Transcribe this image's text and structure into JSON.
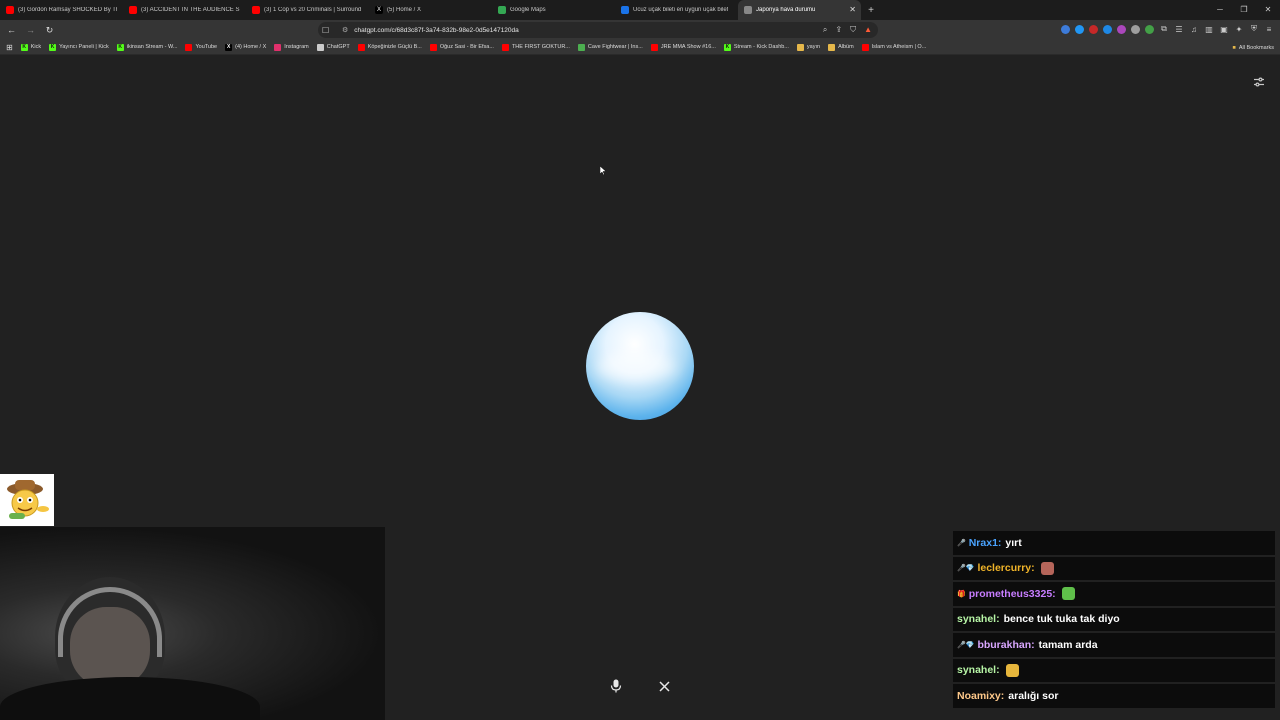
{
  "tabs": [
    {
      "title": "(3) Gordon Ramsay SHOCKED By Th",
      "favicon_color": "#ff0000"
    },
    {
      "title": "(3) ACCIDENT IN THE AUDIENCE STA",
      "favicon_color": "#ff0000"
    },
    {
      "title": "(3) 1 Cop vs 20 Criminals | Surround",
      "favicon_color": "#ff0000"
    },
    {
      "title": "(5) Home / X",
      "favicon_color": "#000000",
      "favicon_glyph": "X"
    },
    {
      "title": "Google Maps",
      "favicon_color": "#34a853"
    },
    {
      "title": "Ucuz uçak bileti en uygun uçak bilet",
      "favicon_color": "#1a73e8"
    },
    {
      "title": "Japonya hava durumu",
      "favicon_color": "#888888",
      "active": true
    }
  ],
  "toolbar": {
    "url": "chatgpt.com/c/68d3c87f-3a74-832b-98e2-0d5e147120da"
  },
  "bookmarks": [
    {
      "label": "Kick",
      "color": "#53fc18",
      "glyph": "K"
    },
    {
      "label": "Yayıncı Paneli | Kick",
      "color": "#53fc18",
      "glyph": "K"
    },
    {
      "label": "ikinsan Stream - W...",
      "color": "#53fc18",
      "glyph": "K"
    },
    {
      "label": "YouTube",
      "color": "#ff0000",
      "glyph": ""
    },
    {
      "label": "(4) Home / X",
      "color": "#000000",
      "glyph": "X"
    },
    {
      "label": "Instagram",
      "color": "#e1306c",
      "glyph": ""
    },
    {
      "label": "ChatGPT",
      "color": "#cccccc",
      "glyph": ""
    },
    {
      "label": "Köpeğinizle Güçlü B...",
      "color": "#ff0000",
      "glyph": ""
    },
    {
      "label": "Oğuz Sasi - Bir Efsa...",
      "color": "#ff0000",
      "glyph": ""
    },
    {
      "label": "THE FIRST GOKTUR...",
      "color": "#ff0000",
      "glyph": ""
    },
    {
      "label": "Cave Fightwear | Ins...",
      "color": "#4caf50",
      "glyph": ""
    },
    {
      "label": "JRE MMA Show #16...",
      "color": "#ff0000",
      "glyph": ""
    },
    {
      "label": "Stream - Kick Dashb...",
      "color": "#53fc18",
      "glyph": "K"
    },
    {
      "label": "yayın",
      "color": "#e6b84a",
      "glyph": ""
    },
    {
      "label": "Albüm",
      "color": "#e6b84a",
      "glyph": ""
    },
    {
      "label": "Islam vs Atheism | O...",
      "color": "#ff0000",
      "glyph": ""
    }
  ],
  "all_bookmarks_label": "All Bookmarks",
  "chat": [
    {
      "user": "Nrax1:",
      "color": "#4aa3ff",
      "text": "yırt",
      "badge": "🎤",
      "emote": ""
    },
    {
      "user": "leclercurry:",
      "color": "#f0b429",
      "text": "",
      "badge": "🎤💎",
      "emote": "#b5655a"
    },
    {
      "user": "prometheus3325:",
      "color": "#c77dff",
      "text": "",
      "badge": "🎁",
      "emote": "#5fbf4a"
    },
    {
      "user": "synahel:",
      "color": "#b7f5a6",
      "text": "bence tuk tuka tak diyo",
      "badge": "",
      "emote": ""
    },
    {
      "user": "bburakhan:",
      "color": "#d9a7ff",
      "text": "tamam arda",
      "badge": "🎤💎",
      "emote": ""
    },
    {
      "user": "synahel:",
      "color": "#b7f5a6",
      "text": "",
      "badge": "",
      "emote": "#e7b63c"
    },
    {
      "user": "Noamixy:",
      "color": "#ffc98a",
      "text": "aralığı sor",
      "badge": "",
      "emote": ""
    }
  ]
}
